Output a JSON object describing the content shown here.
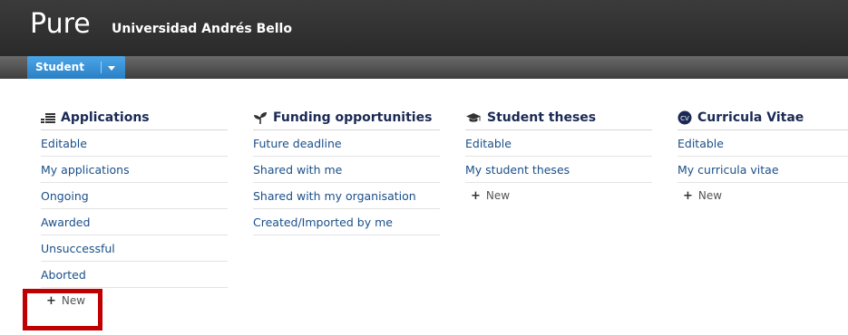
{
  "header": {
    "logo": "Pure",
    "organisation": "Universidad Andrés Bello"
  },
  "nav": {
    "role_tab": "Student"
  },
  "columns": [
    {
      "title": "Applications",
      "icon": "applications-icon",
      "items": [
        "Editable",
        "My applications",
        "Ongoing",
        "Awarded",
        "Unsuccessful",
        "Aborted"
      ],
      "new_label": "New"
    },
    {
      "title": "Funding opportunities",
      "icon": "funding-sprout-icon",
      "items": [
        "Future deadline",
        "Shared with me",
        "Shared with my organisation",
        "Created/Imported by me"
      ]
    },
    {
      "title": "Student theses",
      "icon": "graduation-cap-icon",
      "items": [
        "Editable",
        "My student theses"
      ],
      "new_label": "New"
    },
    {
      "title": "Curricula Vitae",
      "icon": "cv-icon",
      "items": [
        "Editable",
        "My curricula vitae"
      ],
      "new_label": "New"
    }
  ],
  "colors": {
    "header_bg": "#2f2f2f",
    "role_tab_bg": "#3b93d6",
    "title_text": "#1b2a55",
    "link_text": "#1a4f8a",
    "highlight_border": "#c00000"
  }
}
